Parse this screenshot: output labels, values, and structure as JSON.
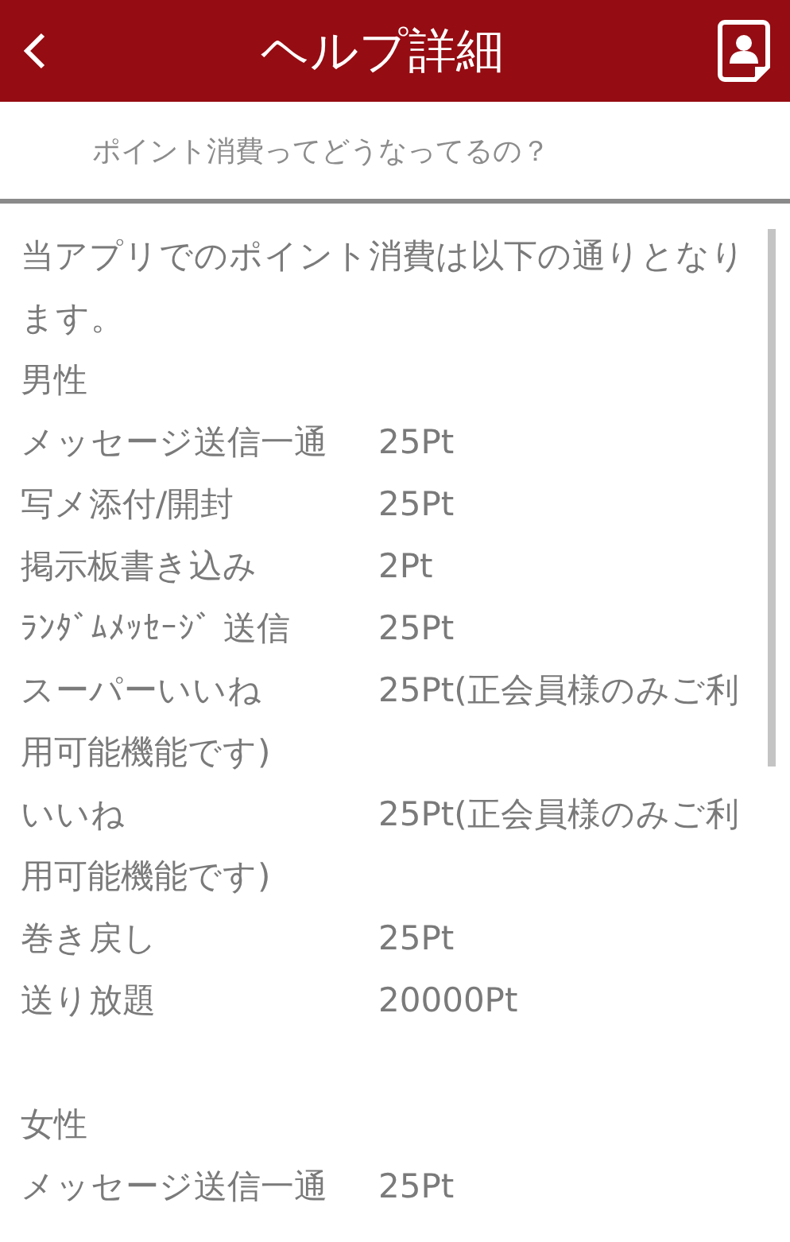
{
  "header": {
    "title": "ヘルプ詳細"
  },
  "question": "ポイント消費ってどうなってるの？",
  "intro": "当アプリでのポイント消費は以下の通りとなります。",
  "lines": [
    {
      "kind": "heading",
      "text": "男性"
    },
    {
      "kind": "entry",
      "label": "メッセージ送信一通",
      "value": "25Pt"
    },
    {
      "kind": "entry",
      "label": "写メ添付/開封",
      "value": "25Pt"
    },
    {
      "kind": "entry",
      "label": "掲示板書き込み",
      "value": "2Pt"
    },
    {
      "kind": "entry",
      "label": "ﾗﾝﾀﾞﾑﾒｯｾｰｼﾞ 送信",
      "value": "25Pt"
    },
    {
      "kind": "entry",
      "label": "スーパーいいね",
      "value": "25Pt(正会員様のみご利"
    },
    {
      "kind": "text",
      "text": "用可能機能です)"
    },
    {
      "kind": "entry",
      "label": "いいね",
      "value": "25Pt(正会員様のみご利"
    },
    {
      "kind": "text",
      "text": "用可能機能です)"
    },
    {
      "kind": "entry",
      "label": "巻き戻し",
      "value": "25Pt"
    },
    {
      "kind": "entry",
      "label": "送り放題",
      "value": "20000Pt"
    },
    {
      "kind": "blank"
    },
    {
      "kind": "heading",
      "text": "女性"
    },
    {
      "kind": "entry",
      "label": "メッセージ送信一通",
      "value": "25Pt"
    }
  ]
}
